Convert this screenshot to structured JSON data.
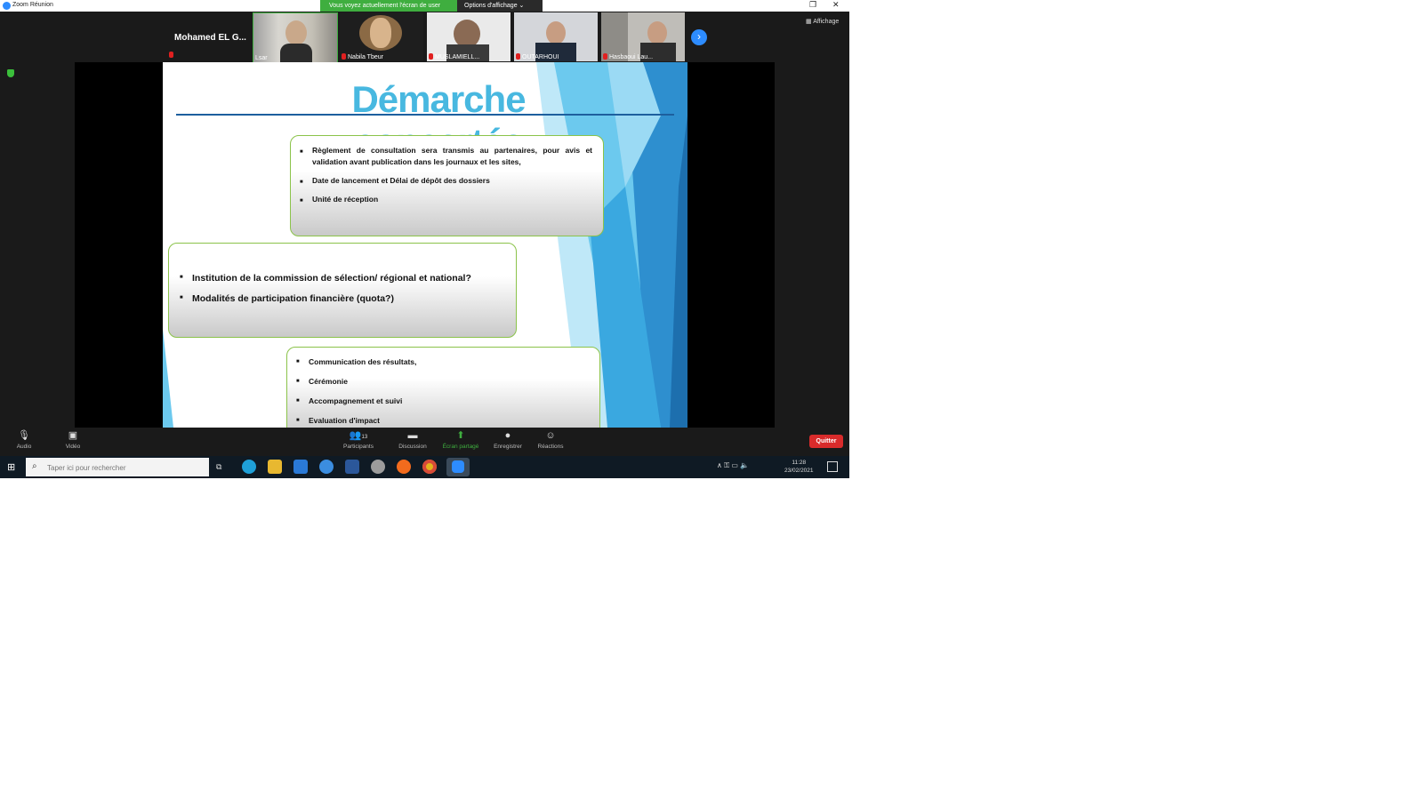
{
  "window": {
    "title": "Zoom Réunion",
    "share_notice": "Vous voyez actuellement l'écran de user",
    "view_options": "Options d'affichage ⌄",
    "layout_label": "Affichage"
  },
  "strip": {
    "active_speaker": "Mohamed EL G...",
    "tiles": [
      {
        "name": "Lsar"
      },
      {
        "name": "Nabila Tbeur"
      },
      {
        "name": "MUSLAMIELL..."
      },
      {
        "name": "OUTARHOUI"
      },
      {
        "name": "Hasbaoui Lau..."
      }
    ]
  },
  "slide": {
    "title": "Démarche concertée",
    "box1": [
      "Règlement de consultation  sera transmis au partenaires, pour avis et validation avant publication dans les journaux et les sites,",
      "Date de lancement et Délai de dépôt des dossiers",
      "Unité de réception"
    ],
    "box2": [
      "Institution de la commission de sélection/ régional et  national?",
      "Modalités de participation financière (quota?)"
    ],
    "box3": [
      "Communication des résultats,",
      "Cérémonie",
      "Accompagnement et suivi",
      "Evaluation d'impact"
    ]
  },
  "controls": {
    "audio": "Audio",
    "video": "Vidéo",
    "participants": "Participants",
    "participants_count": "13",
    "chat": "Discussion",
    "share": "Écran partagé",
    "record": "Enregistrer",
    "reactions": "Réactions",
    "leave": "Quitter"
  },
  "taskbar": {
    "search_placeholder": "Taper ici pour rechercher",
    "time": "11:28",
    "date": "23/02/2021"
  }
}
